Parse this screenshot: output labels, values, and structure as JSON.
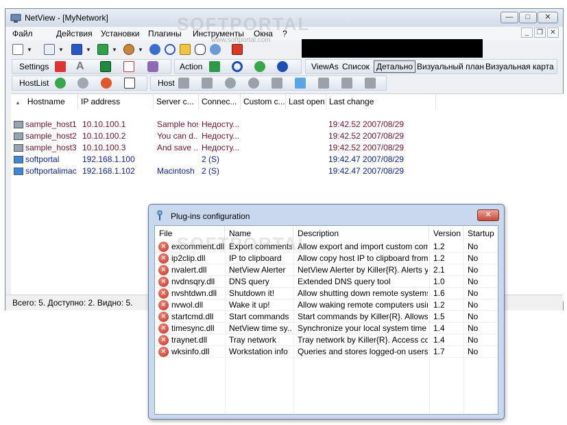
{
  "window": {
    "title": "NetView - [MyNetwork]"
  },
  "menu": [
    "Файл",
    "Действия",
    "Установки",
    "Плагины",
    "Инструменты",
    "Окна",
    "?"
  ],
  "toolbar": {
    "settings_label": "Settings",
    "action_label": "Action",
    "viewas_label": "ViewAs",
    "view_list": "Список",
    "view_detail": "Детально",
    "view_visual_plan": "Визуальный план",
    "view_visual_map": "Визуальная карта",
    "hostlist_label": "HostList",
    "host_label": "Host"
  },
  "columns": [
    "Hostname",
    "IP address",
    "Server c...",
    "Connec...",
    "Custom c...",
    "Last open",
    "Last change"
  ],
  "hosts": [
    {
      "hostname": "sample_host1",
      "ip": "10.10.100.1",
      "server": "Sample host",
      "conn": "Недосту...",
      "custom": "",
      "last_open": "",
      "last_change": "19:42.52 2007/08/29",
      "color": "#7b0f2a"
    },
    {
      "hostname": "sample_host2",
      "ip": "10.10.100.2",
      "server": "You can d...",
      "conn": "Недосту...",
      "custom": "",
      "last_open": "",
      "last_change": "19:42.52 2007/08/29",
      "color": "#7b0f2a"
    },
    {
      "hostname": "sample_host3",
      "ip": "10.10.100.3",
      "server": "And save ...",
      "conn": "Недосту...",
      "custom": "",
      "last_open": "",
      "last_change": "19:42.52 2007/08/29",
      "color": "#7b0f2a"
    },
    {
      "hostname": "softportal",
      "ip": "192.168.1.100",
      "server": "",
      "conn": "2 (S)",
      "custom": "",
      "last_open": "",
      "last_change": "19:42.47 2007/08/29",
      "color": "#0a1f9c"
    },
    {
      "hostname": "softportalimac",
      "ip": "192.168.1.102",
      "server": "Macintosh",
      "conn": "2 (S)",
      "custom": "",
      "last_open": "",
      "last_change": "19:42.47 2007/08/29",
      "color": "#0a1f9c"
    }
  ],
  "status": "Всего: 5. Доступно: 2. Видно: 5.",
  "watermark": {
    "big": "SOFTPORTAL",
    "small": "www.softportal.com"
  },
  "dialog": {
    "title": "Plug-ins configuration",
    "close": "✕",
    "columns": [
      "File",
      "Name",
      "Description",
      "Version",
      "Startup"
    ],
    "plugins": [
      {
        "file": "excomment.dll",
        "name": "Export comments",
        "desc": "Allow export and import custom comm...",
        "version": "1.2",
        "startup": "No"
      },
      {
        "file": "ip2clip.dll",
        "name": "IP to clipboard",
        "desc": "Allow copy host IP to clipboard from h...",
        "version": "1.2",
        "startup": "No"
      },
      {
        "file": "nvalert.dll",
        "name": "NetView Alerter",
        "desc": "NetView Alerter by Killer{R}. Alerts yo...",
        "version": "2.1",
        "startup": "No"
      },
      {
        "file": "nvdnsqry.dll",
        "name": "DNS query",
        "desc": "Extended DNS query tool",
        "version": "1.0",
        "startup": "No"
      },
      {
        "file": "nvshtdwn.dll",
        "name": "Shutdown it!",
        "desc": "Allow shutting down remote systems fr...",
        "version": "1.6",
        "startup": "No"
      },
      {
        "file": "nvwol.dll",
        "name": "Wake it up!",
        "desc": "Allow waking remote computers using...",
        "version": "1.2",
        "startup": "No"
      },
      {
        "file": "startcmd.dll",
        "name": "Start commands",
        "desc": "Start commands by Killer{R}. Allows t...",
        "version": "1.5",
        "startup": "No"
      },
      {
        "file": "timesync.dll",
        "name": "NetView time sy...",
        "desc": "Synchronize your local system time wi...",
        "version": "1.4",
        "startup": "No"
      },
      {
        "file": "traynet.dll",
        "name": "Tray network",
        "desc": "Tray network by Killer{R}. Access co...",
        "version": "1.4",
        "startup": "No"
      },
      {
        "file": "wksinfo.dll",
        "name": "Workstation info",
        "desc": "Queries and stores logged-on users a...",
        "version": "1.7",
        "startup": "No"
      }
    ]
  },
  "colors": {
    "offline_host": "#7b0f2a",
    "online_host": "#0a1f9c",
    "error_icon": "#c62a1b"
  }
}
